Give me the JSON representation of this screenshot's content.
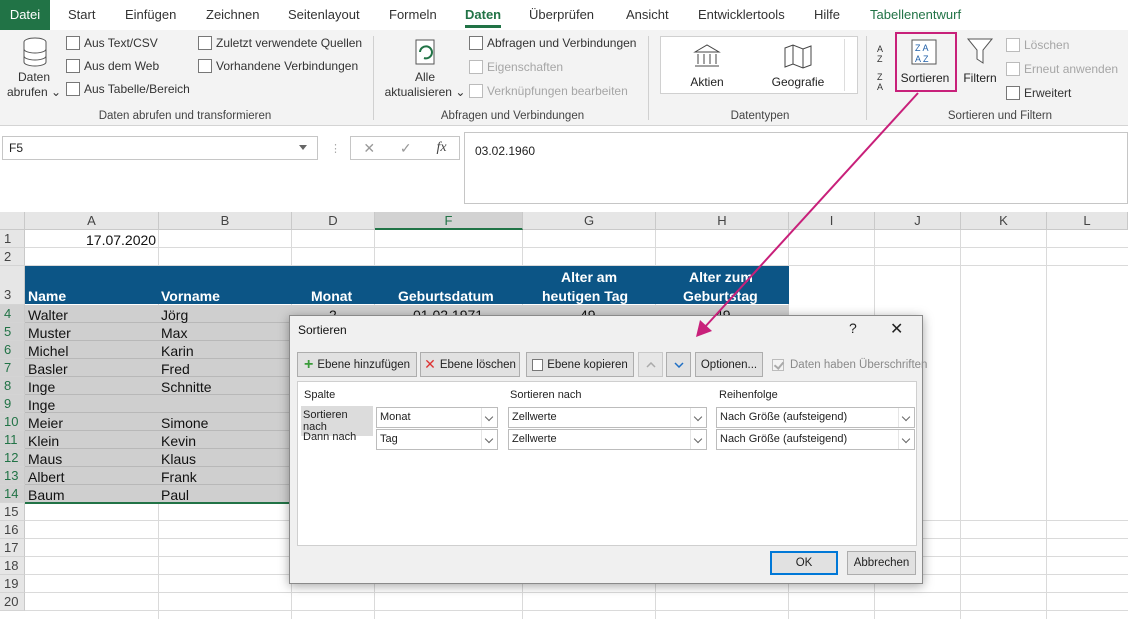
{
  "menu": {
    "file": "Datei",
    "tabs": [
      "Start",
      "Einfügen",
      "Zeichnen",
      "Seitenlayout",
      "Formeln",
      "Daten",
      "Überprüfen",
      "Ansicht",
      "Entwicklertools",
      "Hilfe",
      "Tabellenentwurf"
    ]
  },
  "ribbon": {
    "get_data_line1": "Daten",
    "get_data_line2": "abrufen ⌄",
    "from_text": "Aus Text/CSV",
    "from_web": "Aus dem Web",
    "from_table": "Aus Tabelle/Bereich",
    "recent_sources": "Zuletzt verwendete Quellen",
    "existing_connections": "Vorhandene Verbindungen",
    "group_get": "Daten abrufen und transformieren",
    "refresh_line1": "Alle",
    "refresh_line2": "aktualisieren ⌄",
    "queries_connections": "Abfragen und Verbindungen",
    "properties": "Eigenschaften",
    "edit_links": "Verknüpfungen bearbeiten",
    "group_queries": "Abfragen und Verbindungen",
    "stocks": "Aktien",
    "geography": "Geografie",
    "group_datatypes": "Datentypen",
    "sort": "Sortieren",
    "filter": "Filtern",
    "clear": "Löschen",
    "reapply": "Erneut anwenden",
    "advanced": "Erweitert",
    "group_sort": "Sortieren und Filtern"
  },
  "formula": {
    "name_box": "F5",
    "fx": "fx",
    "value": "03.02.1960"
  },
  "columns": [
    "A",
    "B",
    "D",
    "F",
    "G",
    "H",
    "I",
    "J",
    "K",
    "L"
  ],
  "rows": [
    "1",
    "2",
    "3",
    "4",
    "5",
    "6",
    "7",
    "8",
    "9",
    "10",
    "11",
    "12",
    "13",
    "14",
    "15",
    "16",
    "17",
    "18",
    "19",
    "20"
  ],
  "sheet": {
    "a1": "17.07.2020",
    "headers": {
      "name": "Name",
      "vorname": "Vorname",
      "monat": "Monat",
      "geburtsdatum": "Geburtsdatum",
      "alter_heute_1": "Alter am",
      "alter_heute_2": "heutigen Tag",
      "alter_geb_1": "Alter zum",
      "alter_geb_2": "Geburtstag"
    },
    "names": [
      "Walter",
      "Muster",
      "Michel",
      "Basler",
      "Inge",
      "Inge",
      "Meier",
      "Klein",
      "Maus",
      "Albert",
      "Baum"
    ],
    "firstnames": [
      "Jörg",
      "Max",
      "Karin",
      "Fred",
      "Schnitte",
      "",
      "Simone",
      "Kevin",
      "Klaus",
      "Frank",
      "Paul"
    ],
    "row4_partial": {
      "monat": "2",
      "geburtsdatum": "01.02.1971",
      "alter": "49",
      "alter_geb": "49"
    }
  },
  "dialog": {
    "title": "Sortieren",
    "help": "?",
    "close": "✕",
    "add_level": "Ebene hinzufügen",
    "delete_level": "Ebene löschen",
    "copy_level": "Ebene kopieren",
    "options": "Optionen...",
    "has_headers": "Daten haben Überschriften",
    "col_header": "Spalte",
    "sort_on_header": "Sortieren nach",
    "order_header": "Reihenfolge",
    "levels": [
      {
        "label": "Sortieren nach",
        "column": "Monat",
        "sort_on": "Zellwerte",
        "order": "Nach Größe (aufsteigend)"
      },
      {
        "label": "Dann nach",
        "column": "Tag",
        "sort_on": "Zellwerte",
        "order": "Nach Größe (aufsteigend)"
      }
    ],
    "ok": "OK",
    "cancel": "Abbrechen"
  },
  "colors": {
    "accent": "#217346",
    "header_band": "#0c5586",
    "highlight": "#c8207a"
  }
}
